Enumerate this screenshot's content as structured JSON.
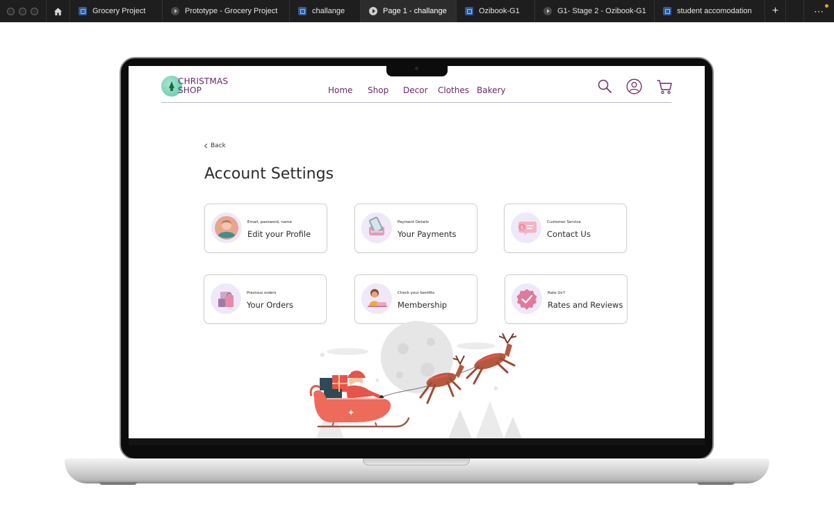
{
  "tabs": [
    {
      "label": "Grocery Project",
      "kind": "file",
      "active": false
    },
    {
      "label": "Prototype - Grocery Project",
      "kind": "play",
      "active": false
    },
    {
      "label": "challange",
      "kind": "file",
      "active": false
    },
    {
      "label": "Page 1 - challange",
      "kind": "play",
      "active": true
    },
    {
      "label": "Ozibook-G1",
      "kind": "file",
      "active": false
    },
    {
      "label": "G1- Stage 2 - Ozibook-G1",
      "kind": "play",
      "active": false
    },
    {
      "label": "student accomodation",
      "kind": "file",
      "active": false
    }
  ],
  "tabbar": {
    "new_tab": "+",
    "more": "⋯",
    "close_glyph": "✕"
  },
  "site": {
    "logo_line1": "CHRISTMAS",
    "logo_line2": "SHOP",
    "nav": [
      "Home",
      "Shop",
      "Decor",
      "Clothes",
      "Bakery"
    ],
    "icons": [
      "search-icon",
      "user-icon",
      "cart-icon"
    ],
    "back_label": "Back",
    "page_title": "Account Settings"
  },
  "cards": [
    {
      "sub": "Email, password, name",
      "main": "Edit your Profile",
      "icon": "profile-avatar-icon"
    },
    {
      "sub": "Payment Details",
      "main": "Your Payments",
      "icon": "payment-phone-icon"
    },
    {
      "sub": "Customer Service",
      "main": "Contact Us",
      "icon": "chat-bubble-icon"
    },
    {
      "sub": "Previous orders",
      "main": "Your Orders",
      "icon": "shopping-bags-icon"
    },
    {
      "sub": "Check your benifits",
      "main": "Membership",
      "icon": "member-person-icon"
    },
    {
      "sub": "Rate Us!!",
      "main": "Rates and Reviews",
      "icon": "check-badge-icon"
    }
  ],
  "colors": {
    "brand": "#6b2663",
    "icon_bubble": "#efe8f8",
    "accent_green": "#5ec5a9",
    "sleigh_red": "#ee6a5b"
  }
}
